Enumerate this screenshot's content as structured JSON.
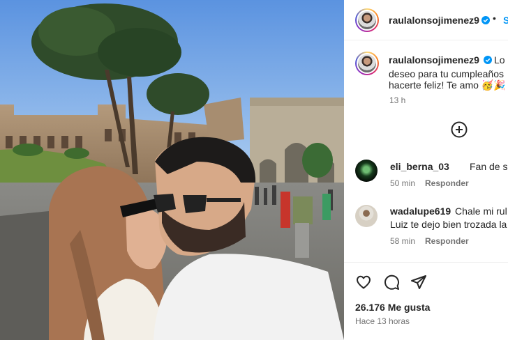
{
  "post": {
    "author": "raulalonsojimenez9",
    "follow_label": "S",
    "dot": "•",
    "caption_lines": [
      "Lo",
      "deseo para tu cumpleaños",
      "hacerte feliz! Te amo 🥳🎉"
    ],
    "caption_time": "13 h"
  },
  "comments": [
    {
      "user": "eli_berna_03",
      "text": "Fan de su re",
      "time": "50 min",
      "reply": "Responder"
    },
    {
      "user": "wadalupe619",
      "text": "Chale mi rul",
      "text2": "Luiz te dejo bien trozada la",
      "time": "58 min",
      "reply": "Responder"
    }
  ],
  "footer": {
    "likes": "26.176 Me gusta",
    "posted": "Hace 13 horas"
  },
  "icons": {
    "verified": "verified-badge-icon",
    "load_more": "plus-circle-icon",
    "like": "heart-icon",
    "comment": "comment-bubble-icon",
    "share": "paper-plane-icon"
  },
  "colors": {
    "link_blue": "#0095f6",
    "verified_blue": "#0095f6",
    "secondary_text": "#737373"
  }
}
